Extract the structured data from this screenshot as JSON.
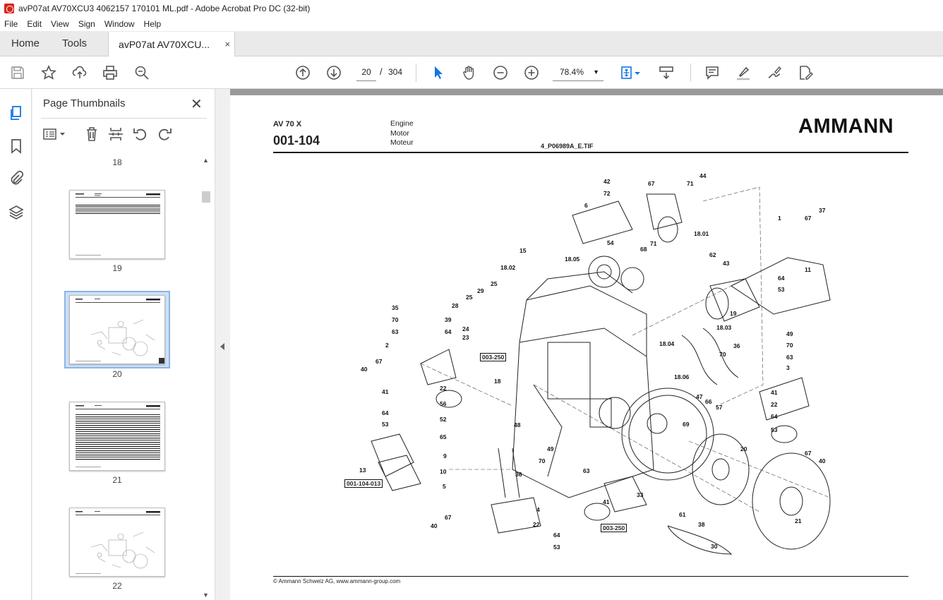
{
  "window": {
    "title": "avP07at AV70XCU3 4062157 170101 ML.pdf - Adobe Acrobat Pro DC (32-bit)"
  },
  "menu": [
    "File",
    "Edit",
    "View",
    "Sign",
    "Window",
    "Help"
  ],
  "tabs": {
    "home": "Home",
    "tools": "Tools",
    "document": "avP07at AV70XCU...",
    "close": "×"
  },
  "toolbar": {
    "icons": [
      "save-icon",
      "star-icon",
      "upload-icon",
      "print-icon",
      "search-zoom-icon",
      "prev-page-icon",
      "next-page-icon",
      "pointer-icon",
      "hand-icon",
      "zoom-out-icon",
      "zoom-in-icon",
      "fit-page-icon",
      "scroll-mode-icon",
      "comment-icon",
      "highlight-icon",
      "sign-icon",
      "edit-pdf-icon"
    ],
    "current_page": "20",
    "page_separator": "/",
    "total_pages": "304",
    "zoom": "78.4%"
  },
  "panel": {
    "title": "Page Thumbnails",
    "close": "✕",
    "thumbnails": [
      {
        "label": "18"
      },
      {
        "label": "19"
      },
      {
        "label": "20",
        "selected": true
      },
      {
        "label": "21"
      },
      {
        "label": "22"
      }
    ]
  },
  "page": {
    "model": "AV 70 X",
    "code": "001-104",
    "lang_en": "Engine",
    "lang_de": "Motor",
    "lang_fr": "Moteur",
    "filename": "4_P06989A_E.TIF",
    "logo": "AMMANN",
    "footer": "© Ammann Schweiz AG, www.ammann-group.com",
    "callouts": [
      "42",
      "67",
      "72",
      "6",
      "71",
      "44",
      "18.01",
      "54",
      "68",
      "71",
      "1",
      "67",
      "37",
      "15",
      "18.05",
      "62",
      "43",
      "18.02",
      "64",
      "53",
      "11",
      "35",
      "28",
      "25",
      "29",
      "25",
      "19",
      "70",
      "39",
      "63",
      "64",
      "24",
      "23",
      "18.03",
      "49",
      "2",
      "003-250",
      "18.04",
      "70",
      "36",
      "70",
      "67",
      "63",
      "40",
      "18",
      "18.06",
      "3",
      "41",
      "22",
      "47",
      "66",
      "41",
      "56",
      "57",
      "22",
      "64",
      "52",
      "69",
      "64",
      "53",
      "48",
      "65",
      "53",
      "9",
      "20",
      "67",
      "49",
      "40",
      "10",
      "70",
      "63",
      "13",
      "001-104-013",
      "36",
      "5",
      "4",
      "41",
      "33",
      "40",
      "67",
      "22",
      "61",
      "38",
      "21",
      "64",
      "003-250",
      "53",
      "30"
    ],
    "refboxes": [
      "003-250",
      "001-104-013",
      "003-250"
    ]
  }
}
